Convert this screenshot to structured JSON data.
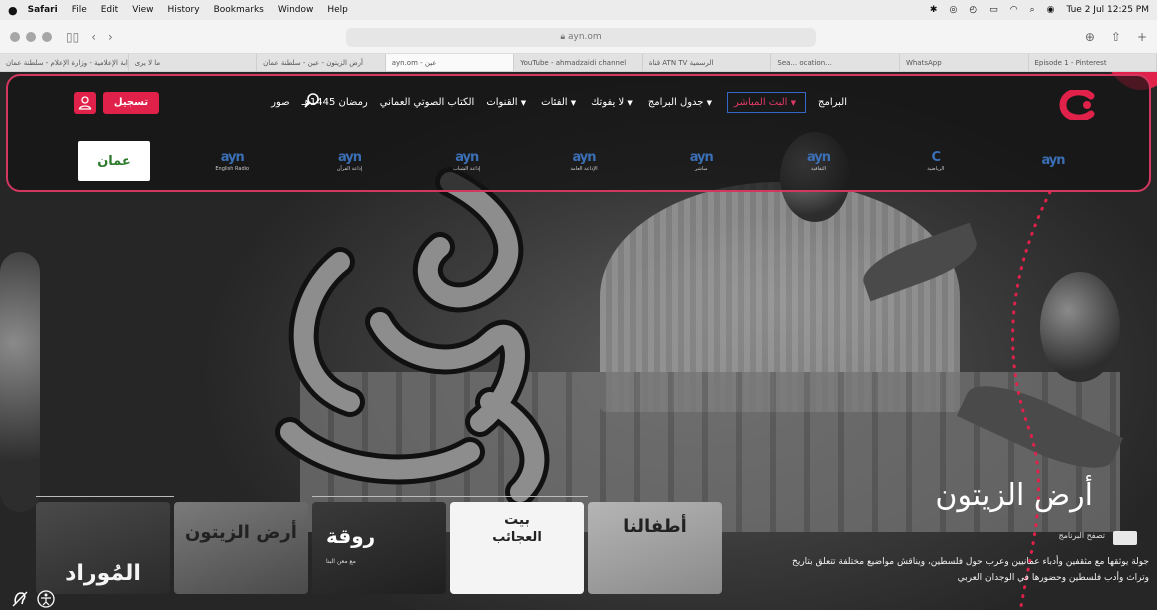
{
  "menubar": {
    "app": "Safari",
    "menus": [
      "File",
      "Edit",
      "View",
      "History",
      "Bookmarks",
      "Window",
      "Help"
    ],
    "clock": "Tue 2 Jul 12:25 PM"
  },
  "toolbar": {
    "url": "ayn.om"
  },
  "tabs": [
    "البوابة الإعلامية - وزارة الإعلام - سلطنة عمان",
    "ما لا يرى",
    "أرض الزيتون - عين - سلطنة عمان",
    "ayn.om - عين",
    "YouTube - ahmadzaidi channel",
    "قناة ATN TV الرسمية",
    "Sea... ocation...",
    "WhatsApp",
    "Episode 1 - Pinterest"
  ],
  "header": {
    "nav": [
      {
        "label": "البرامج",
        "live": false,
        "caret": false
      },
      {
        "label": "البث المباشر",
        "live": true,
        "caret": true
      },
      {
        "label": "جدول البرامج",
        "live": false,
        "caret": true
      },
      {
        "label": "لا يفوتك",
        "live": false,
        "caret": true
      },
      {
        "label": "الفئات",
        "live": false,
        "caret": true
      },
      {
        "label": "القنوات",
        "live": false,
        "caret": true
      },
      {
        "label": "الكتاب الصوتي العماني",
        "live": false,
        "caret": false
      },
      {
        "label": "رمضان 1445هـ",
        "live": false,
        "caret": false
      },
      {
        "label": "صور",
        "live": false,
        "caret": false
      }
    ],
    "register_label": "تسجيل",
    "channels": [
      {
        "mark": "ayn",
        "sub": ""
      },
      {
        "mark": "C",
        "sub": "الرياضية"
      },
      {
        "mark": "ayn",
        "sub": "الثقافية"
      },
      {
        "mark": "ayn",
        "sub": "مباشر"
      },
      {
        "mark": "ayn",
        "sub": "الإذاعة العامة"
      },
      {
        "mark": "ayn",
        "sub": "إذاعة الشباب"
      },
      {
        "mark": "ayn",
        "sub": "إذاعة القرآن"
      },
      {
        "mark": "ayn",
        "sub": "English Radio"
      },
      {
        "mark": "عمان",
        "sub": "",
        "oman": true
      }
    ]
  },
  "hero": {
    "title": "أرض الزيتون",
    "badge_text": "تصفح البرنامج",
    "description": "جولة يوثقها مع مثقفين وأدباء عمانيين وعرب حول فلسطين، ويناقش مواضيع مختلفة تتعلق بتاريخ وتراث وأدب فلسطين وحضورها في الوجدان العربي"
  },
  "thumbnails": [
    {
      "label": "المُوراد"
    },
    {
      "label": "أرض الزيتون"
    },
    {
      "label": "روقة",
      "sub": "مع معن البنا"
    },
    {
      "label": "بيت",
      "label2": "العجائب"
    },
    {
      "label": "أطفالنا"
    }
  ]
}
